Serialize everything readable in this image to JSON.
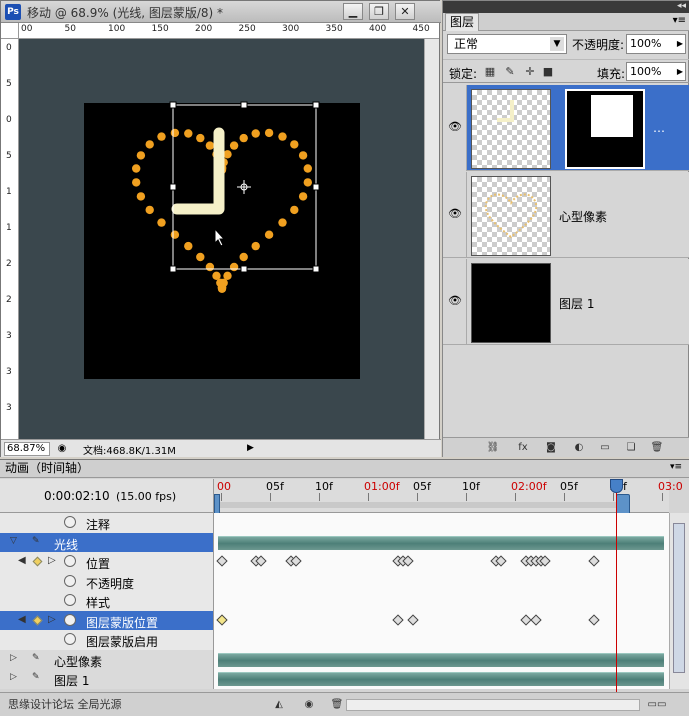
{
  "document": {
    "title": "移动 @ 68.9% (光线, 图层蒙版/8) *",
    "app_icon": "Ps",
    "zoom": "68.87%",
    "doc_info": "文档:468.8K/1.31M",
    "ruler_top": [
      "00",
      "50",
      "100",
      "150",
      "200",
      "250",
      "300",
      "350",
      "400",
      "450"
    ],
    "ruler_left": [
      "0",
      "5",
      "0",
      "5",
      "1",
      "1",
      "2",
      "2",
      "3",
      "3",
      "3"
    ],
    "window_buttons": [
      "minimize",
      "restore",
      "close"
    ]
  },
  "layers_panel": {
    "tab": "图层",
    "blend_mode": "正常",
    "opacity_label": "不透明度:",
    "opacity_value": "100%",
    "lock_label": "锁定:",
    "fill_label": "填充:",
    "fill_value": "100%",
    "layers": [
      {
        "name": "",
        "mask_indicator": "…",
        "selected": true
      },
      {
        "name": "心型像素",
        "selected": false
      },
      {
        "name": "图层 1",
        "selected": false
      }
    ]
  },
  "animation_panel": {
    "tab": "动画（时间轴）",
    "current_time": "0:00:02:10",
    "fps": "(15.00 fps)",
    "time_labels": [
      {
        "text": "00",
        "red": true
      },
      {
        "text": "05f",
        "red": false
      },
      {
        "text": "10f",
        "red": false
      },
      {
        "text": "01:00f",
        "red": true
      },
      {
        "text": "05f",
        "red": false
      },
      {
        "text": "10f",
        "red": false
      },
      {
        "text": "02:00f",
        "red": true
      },
      {
        "text": "05f",
        "red": false
      },
      {
        "text": "10f",
        "red": false
      },
      {
        "text": "03:0",
        "red": true
      }
    ],
    "rows": [
      {
        "label": "注释",
        "kind": "property"
      },
      {
        "label": "光线",
        "kind": "layer",
        "selected": true
      },
      {
        "label": "位置",
        "kind": "keyed",
        "keyframes": [
          0,
          3.5,
          4,
          7,
          7.5,
          18,
          18.5,
          19,
          28,
          28.5,
          31,
          31.5,
          32,
          32.5,
          33,
          38
        ]
      },
      {
        "label": "不透明度",
        "kind": "property"
      },
      {
        "label": "样式",
        "kind": "property"
      },
      {
        "label": "图层蒙版位置",
        "kind": "keyed",
        "selected": true,
        "keyframes": [
          0,
          18,
          19.5,
          31,
          32,
          38
        ]
      },
      {
        "label": "图层蒙版启用",
        "kind": "property"
      },
      {
        "label": "心型像素",
        "kind": "layer"
      },
      {
        "label": "图层 1",
        "kind": "layer"
      }
    ],
    "footer_text": "思缘设计论坛 全局光源",
    "playhead_frame": 38
  },
  "colors": {
    "canvas_bg": "#3a474d",
    "selection_blue": "#3b6fc9",
    "heart_dots": "#f0a020",
    "light_bar": "#f5f0c8",
    "track_bar": "#5f8f88"
  }
}
